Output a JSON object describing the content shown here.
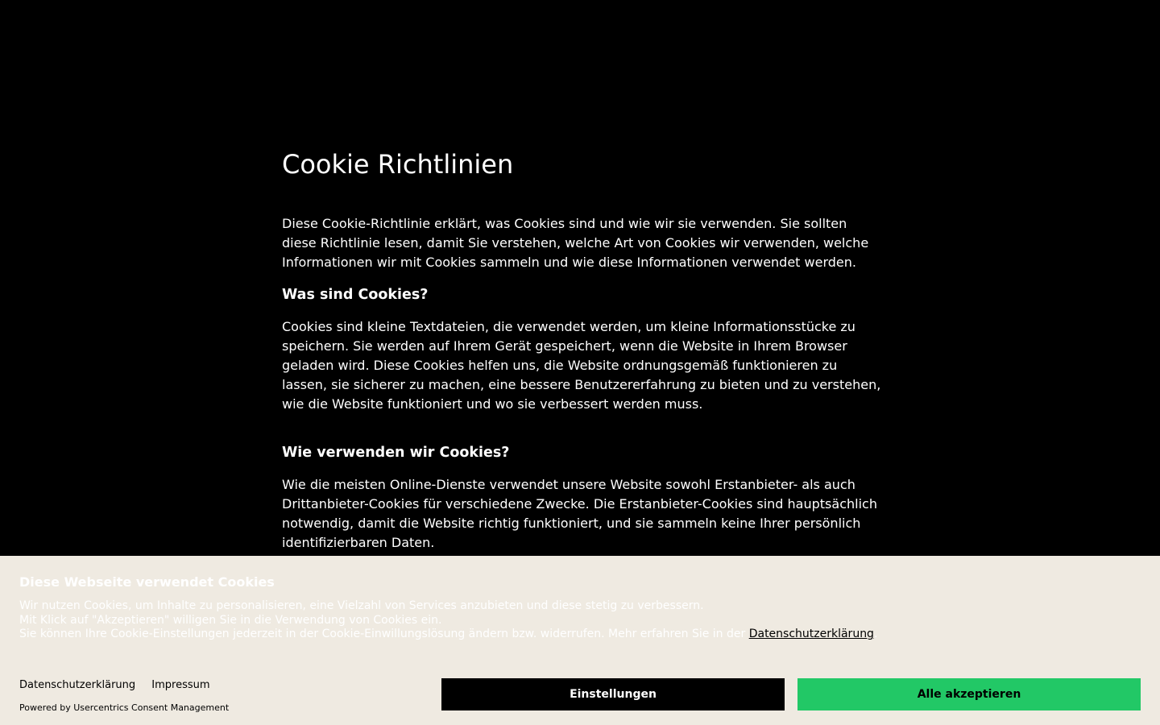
{
  "article": {
    "title": "Cookie Richtlinien",
    "intro": "Diese Cookie-Richtlinie erklärt, was Cookies sind und wie wir sie verwenden. Sie sollten diese Richtlinie lesen, damit Sie verstehen, welche Art von Cookies wir verwenden, welche Informationen wir mit Cookies sammeln und wie diese Informationen verwendet werden.",
    "sections": [
      {
        "heading": "Was sind Cookies?",
        "body": "Cookies sind kleine Textdateien, die verwendet werden, um kleine Informationsstücke zu speichern. Sie werden auf Ihrem Gerät gespeichert, wenn die Website in Ihrem Browser geladen wird. Diese Cookies helfen uns, die Website ordnungsgemäß funktionieren zu lassen, sie sicherer zu machen, eine bessere Benutzererfahrung zu bieten und zu verstehen, wie die Website funktioniert und wo sie verbessert werden muss."
      },
      {
        "heading": "Wie verwenden wir Cookies?",
        "body": "Wie die meisten Online-Dienste verwendet unsere Website sowohl Erstanbieter- als auch Drittanbieter-Cookies für verschiedene Zwecke. Die Erstanbieter-Cookies sind hauptsächlich notwendig, damit die Website richtig funktioniert, und sie sammeln keine Ihrer persönlich identifizierbaren Daten."
      }
    ]
  },
  "banner": {
    "title": "Diese Webseite verwendet Cookies",
    "line1": "Wir nutzen Cookies, um Inhalte zu personalisieren, eine Vielzahl von Services anzubieten und diese stetig zu verbessern.",
    "line2": "Mit Klick auf \"Akzeptieren\" willigen Sie in die Verwendung von Cookies ein.",
    "line3_prefix": "Sie können Ihre Cookie-Einstellungen jederzeit in der Cookie-Einwillungslösung ändern bzw. widerrufen. Mehr erfahren Sie in der ",
    "line3_link": "Datenschutzerklärung",
    "line3_suffix": ".",
    "footer_links": {
      "privacy": "Datenschutzerklärung",
      "imprint": "Impressum"
    },
    "powered_by": "Powered by Usercentrics Consent Management",
    "buttons": {
      "settings": "Einstellungen",
      "accept_all": "Alle akzeptieren"
    },
    "colors": {
      "background": "#efeae1",
      "accept_button": "#22c866",
      "settings_button": "#000000"
    }
  }
}
